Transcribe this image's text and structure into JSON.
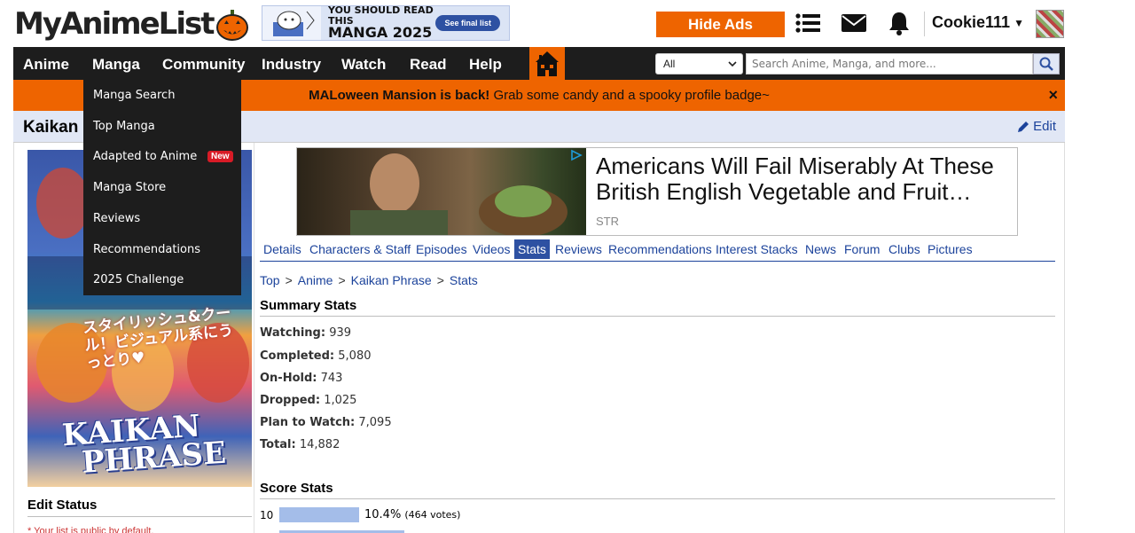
{
  "header": {
    "logo_text": "MyAnimeList",
    "banner_ad": {
      "line1": "YOU SHOULD READ THIS",
      "line2": "MANGA 2025",
      "cta": "See final list"
    },
    "hide_ads": "Hide Ads",
    "username": "Cookie111"
  },
  "nav": {
    "items": [
      "Anime",
      "Manga",
      "Community",
      "Industry",
      "Watch",
      "Read",
      "Help"
    ],
    "select_value": "All",
    "search_placeholder": "Search Anime, Manga, and more..."
  },
  "dropdown": {
    "items": [
      "Manga Search",
      "Top Manga",
      "Adapted to Anime",
      "Manga Store",
      "Reviews",
      "Recommendations",
      "2025 Challenge"
    ],
    "new_badge": "New"
  },
  "promo": {
    "bold": "MALoween Mansion is back!",
    "text": " Grab some candy and a spooky profile badge~",
    "close": "×"
  },
  "title_bar": {
    "title": "Kaikan Phrase",
    "edit": "Edit"
  },
  "cover": {
    "jp_line": "スタイリッシュ&クール！ビジュアル系にうっとり♥",
    "title_line1": "KAIKAN",
    "title_line2": "PHRASE"
  },
  "sidebar": {
    "edit_status": "Edit Status",
    "note": "* Your list is public by default."
  },
  "ad": {
    "headline_line1": "Americans Will Fail Miserably At These",
    "headline_line2": "British English Vegetable and Fruit…",
    "source": "STR"
  },
  "tabs": [
    "Details",
    "Characters & Staff",
    "Episodes",
    "Videos",
    "Stats",
    "Reviews",
    "Recommendations",
    "Interest Stacks",
    "News",
    "Forum",
    "Clubs",
    "Pictures"
  ],
  "active_tab": "Stats",
  "breadcrumb": [
    "Top",
    "Anime",
    "Kaikan Phrase",
    "Stats"
  ],
  "breadcrumb_sep": ">",
  "summary": {
    "heading": "Summary Stats",
    "rows": [
      {
        "label": "Watching:",
        "value": "939"
      },
      {
        "label": "Completed:",
        "value": "5,080"
      },
      {
        "label": "On-Hold:",
        "value": "743"
      },
      {
        "label": "Dropped:",
        "value": "1,025"
      },
      {
        "label": "Plan to Watch:",
        "value": "7,095"
      },
      {
        "label": "Total:",
        "value": "14,882"
      }
    ]
  },
  "score_stats": {
    "heading": "Score Stats",
    "rows": [
      {
        "score": "10",
        "percent": 10.4,
        "percent_label": "10.4%",
        "votes": "(464 votes)"
      }
    ]
  },
  "colors": {
    "accent_orange": "#ee6400",
    "nav_bg": "#1d1d1d",
    "link_blue": "#1c439b",
    "active_tab_bg": "#2e51a2",
    "score_bar": "#a4bde9"
  }
}
